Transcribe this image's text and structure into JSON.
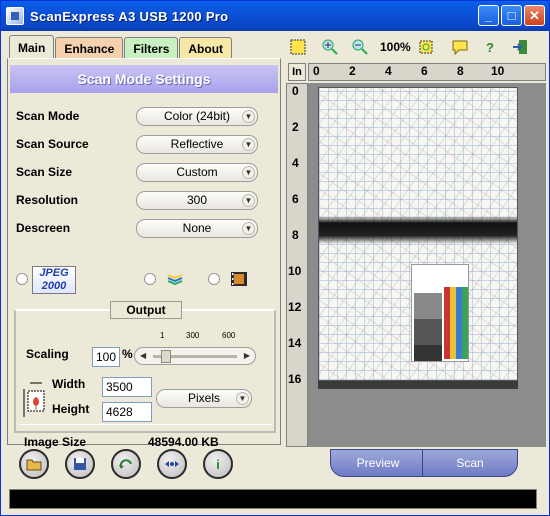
{
  "window": {
    "title": "ScanExpress A3 USB 1200 Pro"
  },
  "tabs": [
    "Main",
    "Enhance",
    "Filters",
    "About"
  ],
  "panel": {
    "header": "Scan Mode Settings"
  },
  "settings": [
    {
      "label": "Scan Mode",
      "value": "Color (24bit)"
    },
    {
      "label": "Scan Source",
      "value": "Reflective"
    },
    {
      "label": "Scan Size",
      "value": "Custom"
    },
    {
      "label": "Resolution",
      "value": "300"
    },
    {
      "label": "Descreen",
      "value": "None"
    }
  ],
  "format_icons": {
    "jpeg_label": "JPEG 2000"
  },
  "output": {
    "title": "Output",
    "scaling_label": "Scaling",
    "scaling_value": "100",
    "scaling_unit": "%",
    "slider_ticks": [
      "1",
      "300",
      "600"
    ],
    "width_label": "Width",
    "width_value": "3500",
    "height_label": "Height",
    "height_value": "4628",
    "unit_value": "Pixels",
    "image_size_label": "Image Size",
    "image_size_value": "48594.00 KB"
  },
  "preview_toolbar": {
    "zoom": "100%"
  },
  "ruler": {
    "unit": "In",
    "top": [
      "0",
      "2",
      "4",
      "6",
      "8",
      "10"
    ],
    "left": [
      "0",
      "2",
      "4",
      "6",
      "8",
      "10",
      "12",
      "14",
      "16"
    ]
  },
  "preview_buttons": {
    "preview": "Preview",
    "scan": "Scan"
  },
  "icons": [
    "open-icon",
    "save-icon",
    "reset-icon",
    "fit-icon",
    "info-icon",
    "select-icon",
    "zoom-in-icon",
    "zoom-out-icon",
    "autofit-icon",
    "help-balloon-icon",
    "help-icon",
    "exit-icon"
  ]
}
